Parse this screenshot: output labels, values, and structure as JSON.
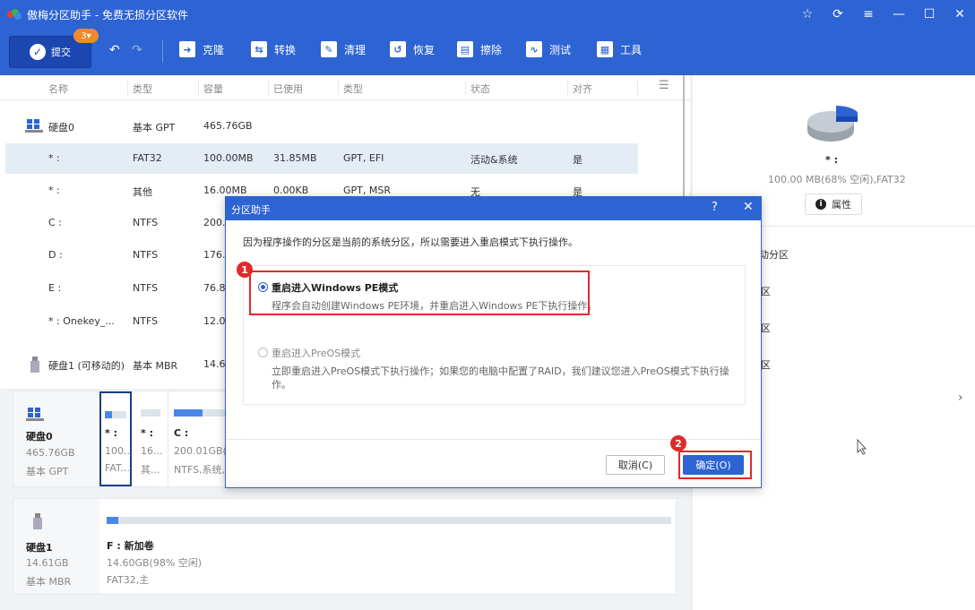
{
  "app": {
    "title": "傲梅分区助手 - 免费无损分区软件"
  },
  "toolbar": {
    "submit_label": "提交",
    "pending_count": "3",
    "tools": [
      "克隆",
      "转换",
      "清理",
      "恢复",
      "擦除",
      "测试",
      "工具"
    ]
  },
  "table": {
    "headers": [
      "名称",
      "类型",
      "容量",
      "已使用",
      "类型",
      "状态",
      "对齐"
    ],
    "rows": [
      {
        "name": "硬盘0",
        "type": "基本 GPT",
        "capacity": "465.76GB",
        "used": "",
        "fs": "",
        "status": "",
        "align": ""
      },
      {
        "name": "* :",
        "type": "FAT32",
        "capacity": "100.00MB",
        "used": "31.85MB",
        "fs": "GPT, EFI",
        "status": "活动&系统",
        "align": "是"
      },
      {
        "name": "* :",
        "type": "其他",
        "capacity": "16.00MB",
        "used": "0.00KB",
        "fs": "GPT, MSR",
        "status": "无",
        "align": "是"
      },
      {
        "name": "C :",
        "type": "NTFS",
        "capacity": "200.0",
        "used": "",
        "fs": "",
        "status": "",
        "align": ""
      },
      {
        "name": "D :",
        "type": "NTFS",
        "capacity": "176.",
        "used": "",
        "fs": "",
        "status": "",
        "align": ""
      },
      {
        "name": "E :",
        "type": "NTFS",
        "capacity": "76.82",
        "used": "",
        "fs": "",
        "status": "",
        "align": ""
      },
      {
        "name": "* : Onekey_...",
        "type": "NTFS",
        "capacity": "12.0",
        "used": "",
        "fs": "",
        "status": "",
        "align": ""
      },
      {
        "name": "硬盘1 (可移动的)",
        "type": "基本 MBR",
        "capacity": "14.6",
        "used": "",
        "fs": "",
        "status": "",
        "align": ""
      }
    ]
  },
  "diskmap": {
    "disk0": {
      "name": "硬盘0",
      "size": "465.76GB",
      "type": "基本 GPT",
      "parts": [
        {
          "label": "* :",
          "size": "100...",
          "fs": "FAT...",
          "fill": 0.32
        },
        {
          "label": "* :",
          "size": "16...",
          "fs": "其...",
          "fill": 0.0
        },
        {
          "label": "C :",
          "size": "200.01GB(8",
          "fs": "NTFS,系统,主",
          "fill": 0.55
        }
      ]
    },
    "disk1": {
      "name": "硬盘1",
      "size": "14.61GB",
      "type": "基本 MBR",
      "part": {
        "label": "F : 新加卷",
        "size": "14.60GB(98% 空闲)",
        "fs": "FAT32,主",
        "fill": 0.02
      }
    }
  },
  "right": {
    "part_name": "* :",
    "part_info": "100.00 MB(68% 空闲),FAT32",
    "prop_label": "属性",
    "partial": [
      "动分区",
      "区",
      "区",
      "区"
    ]
  },
  "dialog": {
    "title": "分区助手",
    "message": "因为程序操作的分区是当前的系统分区，所以需要进入重启模式下执行操作。",
    "opt1_label": "重启进入Windows PE模式",
    "opt1_desc": "程序会自动创建Windows PE环境，并重启进入Windows PE下执行操作。",
    "opt2_label": "重启进入PreOS模式",
    "opt2_desc1": "立即重启进入PreOS模式下执行操作；如果您的电脑中配置了RAID，我们建议您进入PreOS模式下执行操",
    "opt2_desc2": "作。",
    "cancel_label": "取消(C)",
    "ok_label": "确定(O)",
    "step1": "1",
    "step2": "2"
  },
  "colors": {
    "accent": "#2d63d2",
    "highlight": "#e02a2a",
    "badge": "#f08a2c"
  }
}
